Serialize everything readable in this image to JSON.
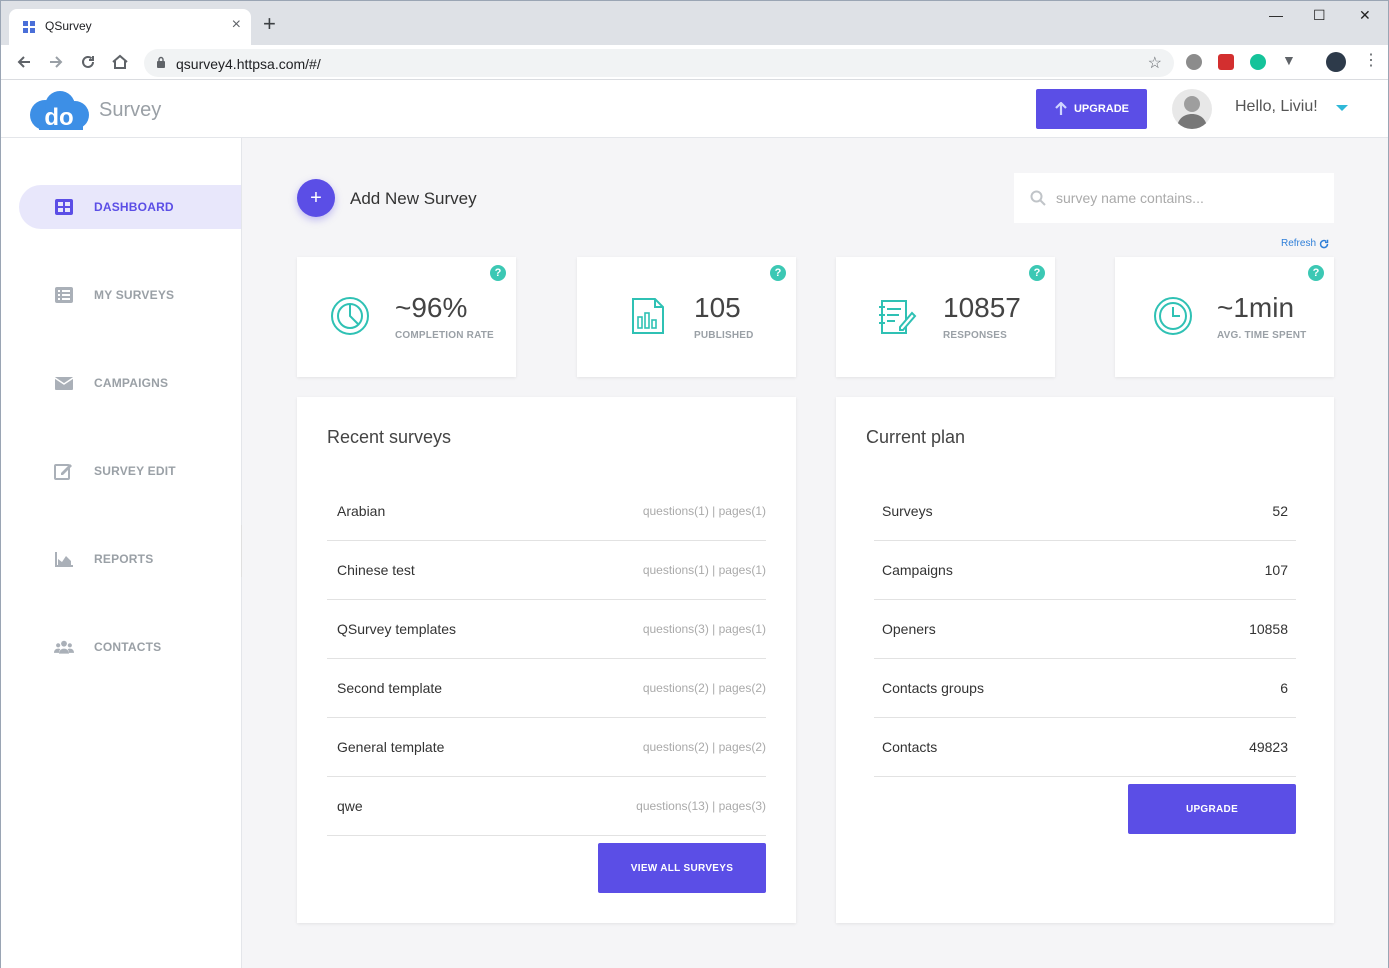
{
  "browser": {
    "tab_title": "QSurvey",
    "tab_close": "×",
    "new_tab": "+",
    "url": "qsurvey4.httpsa.com/#/",
    "minimize": "—",
    "maximize": "☐",
    "close": "✕"
  },
  "header": {
    "logo_text": "do",
    "app_name": "Survey",
    "upgrade_label": "UPGRADE",
    "greeting": "Hello, Liviu!"
  },
  "sidebar": {
    "items": [
      {
        "label": "DASHBOARD",
        "icon": "dashboard-icon",
        "active": true
      },
      {
        "label": "MY SURVEYS",
        "icon": "list-icon",
        "active": false
      },
      {
        "label": "CAMPAIGNS",
        "icon": "envelope-icon",
        "active": false
      },
      {
        "label": "SURVEY EDIT",
        "icon": "edit-icon",
        "active": false
      },
      {
        "label": "REPORTS",
        "icon": "area-chart-icon",
        "active": false
      },
      {
        "label": "CONTACTS",
        "icon": "users-icon",
        "active": false
      }
    ],
    "collapse": "‹"
  },
  "main": {
    "add_new_label": "Add New Survey",
    "search_placeholder": "survey name contains...",
    "refresh_label": "Refresh",
    "stats": [
      {
        "value": "~96%",
        "label": "COMPLETION RATE",
        "help": "?"
      },
      {
        "value": "105",
        "label": "PUBLISHED",
        "help": "?"
      },
      {
        "value": "10857",
        "label": "RESPONSES",
        "help": "?"
      },
      {
        "value": "~1min",
        "label": "AVG. TIME SPENT",
        "help": "?"
      }
    ],
    "recent": {
      "title": "Recent surveys",
      "rows": [
        {
          "name": "Arabian",
          "meta": "questions(1) | pages(1)"
        },
        {
          "name": "Chinese test",
          "meta": "questions(1) | pages(1)"
        },
        {
          "name": "QSurvey templates",
          "meta": "questions(3) | pages(1)"
        },
        {
          "name": "Second template",
          "meta": "questions(2) | pages(2)"
        },
        {
          "name": "General template",
          "meta": "questions(2) | pages(2)"
        },
        {
          "name": "qwe",
          "meta": "questions(13) | pages(3)"
        }
      ],
      "button": "VIEW ALL SURVEYS"
    },
    "plan": {
      "title": "Current plan",
      "rows": [
        {
          "name": "Surveys",
          "value": "52"
        },
        {
          "name": "Campaigns",
          "value": "107"
        },
        {
          "name": "Openers",
          "value": "10858"
        },
        {
          "name": "Contacts groups",
          "value": "6"
        },
        {
          "name": "Contacts",
          "value": "49823"
        }
      ],
      "button": "UPGRADE"
    }
  },
  "colors": {
    "accent": "#5b4ee6",
    "teal": "#2fc1b4",
    "active_bg": "#e8e7fb"
  }
}
